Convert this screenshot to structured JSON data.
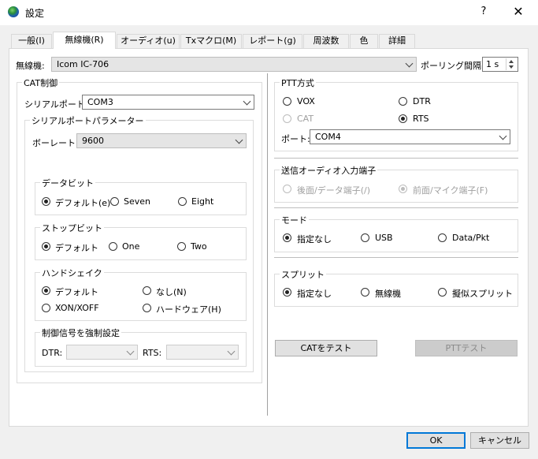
{
  "window": {
    "title": "設定",
    "help_label": "?",
    "close_label": "✕",
    "icon": "globe-icon"
  },
  "tabs": [
    {
      "label": "一般(I)",
      "active": false
    },
    {
      "label": "無線機(R)",
      "active": true
    },
    {
      "label": "オーディオ(u)",
      "active": false
    },
    {
      "label": "Txマクロ(M)",
      "active": false
    },
    {
      "label": "レポート(g)",
      "active": false
    },
    {
      "label": "周波数",
      "active": false
    },
    {
      "label": "色",
      "active": false
    },
    {
      "label": "詳細",
      "active": false
    }
  ],
  "radio_row": {
    "label": "無線機:",
    "value": "Icom IC-706",
    "polling_label": "ポーリング間隔:",
    "polling_value": "1 s"
  },
  "cat": {
    "title": "CAT制御",
    "serial_port_label": "シリアルポート:",
    "serial_port_value": "COM3",
    "params_title": "シリアルポートパラメーター",
    "baud_label": "ボーレート:",
    "baud_value": "9600",
    "databits": {
      "title": "データビット",
      "options": [
        "デフォルト(e)",
        "Seven",
        "Eight"
      ],
      "selected": 0
    },
    "stopbits": {
      "title": "ストップビット",
      "options": [
        "デフォルト",
        "One",
        "Two"
      ],
      "selected": 0
    },
    "handshake": {
      "title": "ハンドシェイク",
      "options": [
        "デフォルト",
        "なし(N)",
        "XON/XOFF",
        "ハードウェア(H)"
      ],
      "selected": 0
    },
    "force": {
      "title": "制御信号を強制設定",
      "dtr_label": "DTR:",
      "rts_label": "RTS:",
      "dtr_value": "",
      "rts_value": ""
    }
  },
  "ptt": {
    "title": "PTT方式",
    "options": [
      {
        "label": "VOX",
        "selected": false,
        "disabled": false
      },
      {
        "label": "DTR",
        "selected": false,
        "disabled": false
      },
      {
        "label": "CAT",
        "selected": false,
        "disabled": true
      },
      {
        "label": "RTS",
        "selected": true,
        "disabled": false
      }
    ],
    "port_label": "ポート:",
    "port_value": "COM4"
  },
  "tx_audio": {
    "title": "送信オーディオ入力端子",
    "options": [
      {
        "label": "後面/データ端子(/)",
        "selected": false,
        "disabled": true
      },
      {
        "label": "前面/マイク端子(F)",
        "selected": true,
        "disabled": true
      }
    ]
  },
  "mode": {
    "title": "モード",
    "options": [
      "指定なし",
      "USB",
      "Data/Pkt"
    ],
    "selected": 0
  },
  "split": {
    "title": "スプリット",
    "options": [
      "指定なし",
      "無線機",
      "擬似スプリット"
    ],
    "selected": 0
  },
  "buttons": {
    "test_cat": "CATをテスト",
    "test_ptt": "PTTテスト",
    "ok": "OK",
    "cancel": "キャンセル"
  }
}
